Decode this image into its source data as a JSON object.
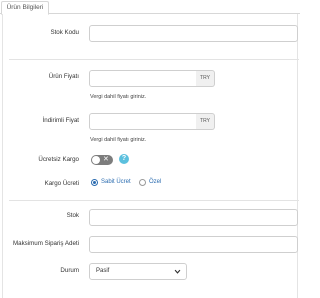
{
  "tabs": [
    {
      "label": "Ürün Bilgileri"
    }
  ],
  "form": {
    "stock_code": {
      "label": "Stok Kodu",
      "value": ""
    },
    "price": {
      "label": "Ürün Fiyatı",
      "value": "",
      "currency": "TRY",
      "help": "Vergi dahil fiyatı giriniz."
    },
    "discount_price": {
      "label": "İndirimli Fiyat",
      "value": "",
      "currency": "TRY",
      "help": "Vergi dahil fiyatı giriniz."
    },
    "free_shipping": {
      "label": "Ücretsiz Kargo",
      "enabled": false,
      "info_icon": "question-icon"
    },
    "shipping_fee": {
      "label": "Kargo Ücreti",
      "options": [
        {
          "label": "Sabit Ücret",
          "checked": true
        },
        {
          "label": "Özel",
          "checked": false
        }
      ]
    },
    "stock": {
      "label": "Stok",
      "value": ""
    },
    "max_order": {
      "label": "Maksimum Sipariş Adeti",
      "value": ""
    },
    "status": {
      "label": "Durum",
      "selected": "Pasif"
    }
  },
  "colors": {
    "accent": "#2b6cb0",
    "info": "#5bc0de",
    "toggle_off": "#7d7d7d"
  }
}
